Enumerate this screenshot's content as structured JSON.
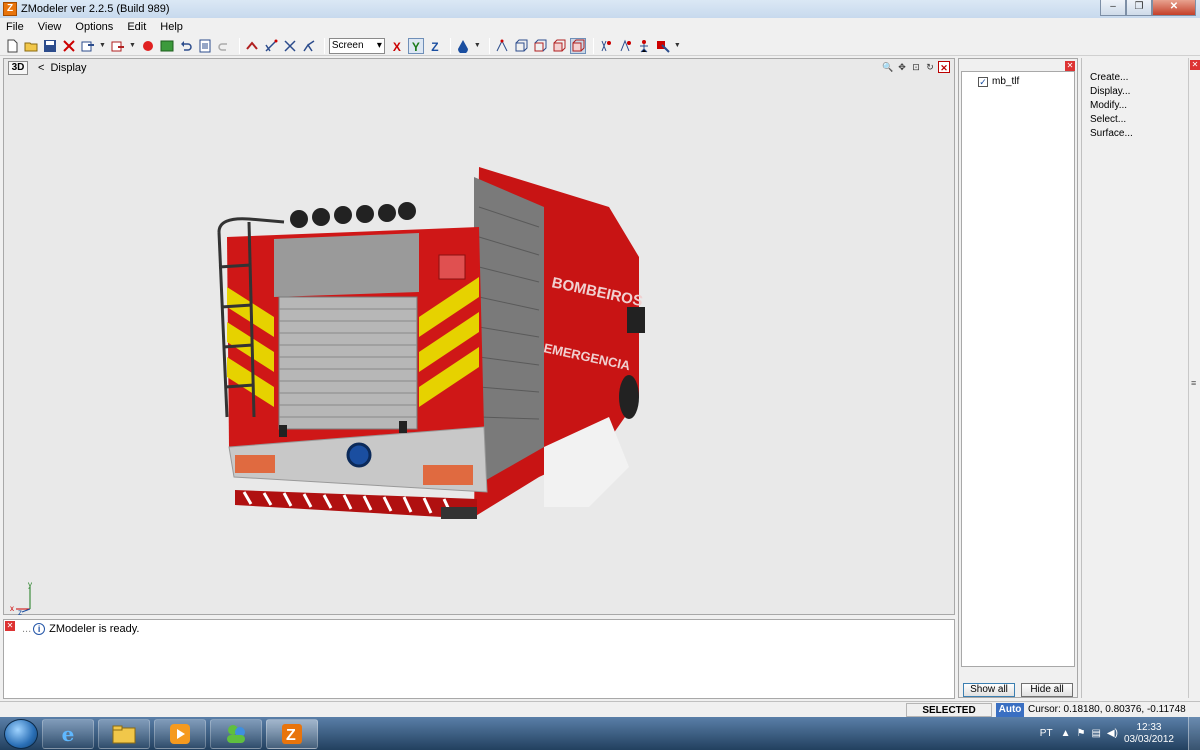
{
  "window": {
    "title": "ZModeler ver 2.2.5 (Build 989)",
    "app_icon": "Z",
    "controls": {
      "minimize": "–",
      "maximize": "❐",
      "close": "✕"
    }
  },
  "menu": [
    "File",
    "View",
    "Options",
    "Edit",
    "Help"
  ],
  "toolbar": {
    "coordinate_system": "Screen",
    "axes": [
      "X",
      "Y",
      "Z"
    ]
  },
  "viewport": {
    "mode": "3D",
    "title": "Display",
    "back_arrow": "<",
    "axis_labels": {
      "y": "y",
      "x": "x",
      "z": "z"
    }
  },
  "log": {
    "prefix": "...",
    "message": "ZModeler is ready."
  },
  "hierarchy": {
    "items": [
      {
        "label": "mb_tlf",
        "checked": true
      }
    ],
    "show_all": "Show all",
    "hide_all": "Hide all"
  },
  "commands": [
    "Create...",
    "Display...",
    "Modify...",
    "Select...",
    "Surface..."
  ],
  "status": {
    "mode": "SELECTED MODE",
    "auto": "Auto",
    "cursor": "Cursor: 0.18180, 0.80376, -0.11748"
  },
  "taskbar": {
    "language": "PT",
    "time": "12:33",
    "date": "03/03/2012"
  },
  "truck_text": {
    "side_top": "BOMBEIROS",
    "side_bottom": "EMERGENCIA"
  },
  "colors": {
    "truck_red": "#d01818",
    "stripe_yellow": "#e6d200",
    "viewport_bg": "#e9e9e9"
  }
}
